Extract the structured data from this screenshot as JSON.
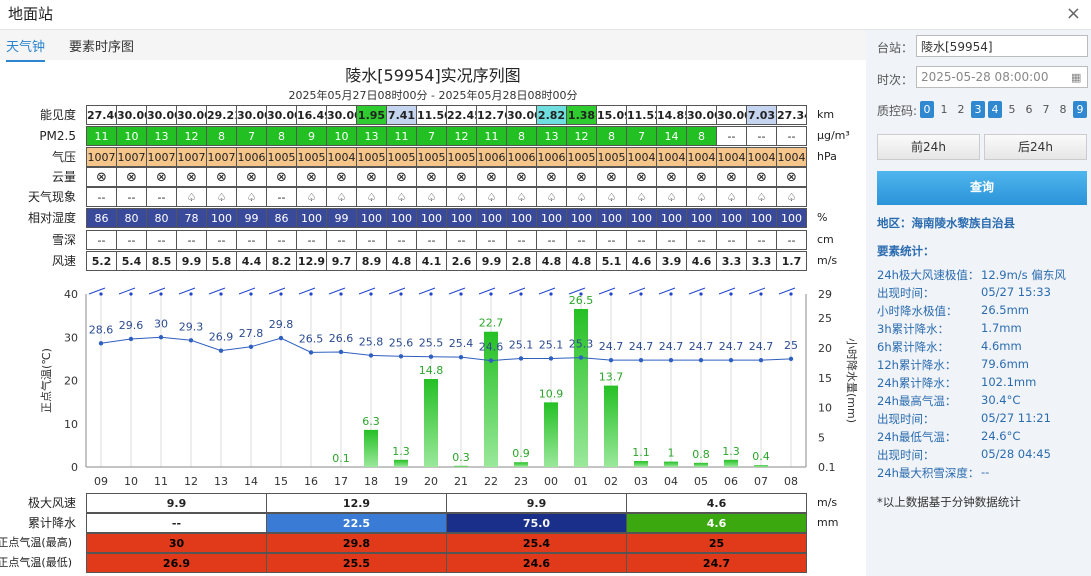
{
  "window": {
    "title": "地面站",
    "close": "×"
  },
  "tabs": [
    "天气钟",
    "要素时序图"
  ],
  "title": "陵水[59954]实况序列图",
  "subtitle": "2025年05月27日08时00分 - 2025年05月28日08时00分",
  "colors": {
    "accent": "#2b85d0",
    "vis_high": "#2ecc2e",
    "vis_mid": "#6fdede",
    "vis_low": "#c5d5f0",
    "pm_green": "#22c022",
    "press": "#f5c58a",
    "rh": "#3a4a9a",
    "bar": "#2fc42f",
    "line": "#2f5fbf"
  },
  "rows": [
    {
      "label": "能见度",
      "unit": "km",
      "values": [
        "27.40",
        "30.00",
        "30.00",
        "30.00",
        "29.21",
        "30.00",
        "30.00",
        "16.49",
        "30.00",
        "1.95",
        "7.41",
        "11.50",
        "22.45",
        "12.76",
        "30.00",
        "2.82",
        "1.38",
        "15.09",
        "11.52",
        "14.85",
        "30.00",
        "30.00",
        "7.03",
        "27.34"
      ]
    },
    {
      "label": "PM2.5",
      "unit": "μg/m³",
      "values": [
        "11",
        "10",
        "13",
        "12",
        "8",
        "7",
        "8",
        "9",
        "10",
        "13",
        "11",
        "7",
        "12",
        "11",
        "8",
        "13",
        "12",
        "8",
        "7",
        "14",
        "8",
        "--",
        "--",
        "--"
      ]
    },
    {
      "label": "气压",
      "unit": "hPa",
      "values": [
        "1007",
        "1007",
        "1007",
        "1007",
        "1007",
        "1006",
        "1005",
        "1005",
        "1004",
        "1005",
        "1005",
        "1005",
        "1005",
        "1006",
        "1006",
        "1006",
        "1005",
        "1005",
        "1004",
        "1004",
        "1004",
        "1004",
        "1004",
        "1004"
      ]
    },
    {
      "label": "云量",
      "unit": "",
      "values": [
        "⊗",
        "⊗",
        "⊗",
        "⊗",
        "⊗",
        "⊗",
        "⊗",
        "⊗",
        "⊗",
        "⊗",
        "⊗",
        "⊗",
        "⊗",
        "⊗",
        "⊗",
        "⊗",
        "⊗",
        "⊗",
        "⊗",
        "⊗",
        "⊗",
        "⊗",
        "⊗",
        "⊗"
      ]
    },
    {
      "label": "天气现象",
      "unit": "",
      "values": [
        "--",
        "--",
        "--",
        "♤",
        "♤",
        "♤",
        "--",
        "♤",
        "♤",
        "♤",
        "♤",
        "♤",
        "♤",
        "♤",
        "♤",
        "♤",
        "♤",
        "♤",
        "♤",
        "♤",
        "♤",
        "♤",
        "♤",
        "♤"
      ]
    },
    {
      "label": "相对湿度",
      "unit": "%",
      "values": [
        "86",
        "80",
        "80",
        "78",
        "100",
        "99",
        "86",
        "100",
        "99",
        "100",
        "100",
        "100",
        "100",
        "100",
        "100",
        "100",
        "100",
        "100",
        "100",
        "100",
        "100",
        "100",
        "100",
        "100"
      ]
    },
    {
      "label": "雪深",
      "unit": "cm",
      "values": [
        "--",
        "--",
        "--",
        "--",
        "--",
        "--",
        "--",
        "--",
        "--",
        "--",
        "--",
        "--",
        "--",
        "--",
        "--",
        "--",
        "--",
        "--",
        "--",
        "--",
        "--",
        "--",
        "--",
        "--"
      ]
    },
    {
      "label": "风速",
      "unit": "m/s",
      "values": [
        "5.2",
        "5.4",
        "8.5",
        "9.9",
        "5.8",
        "4.4",
        "8.2",
        "12.9",
        "9.7",
        "8.9",
        "4.8",
        "4.1",
        "2.6",
        "9.9",
        "2.8",
        "4.8",
        "4.8",
        "5.1",
        "4.6",
        "3.9",
        "4.6",
        "3.3",
        "3.3",
        "1.7"
      ]
    }
  ],
  "chart_data": {
    "type": "bar+line",
    "x": [
      "09",
      "10",
      "11",
      "12",
      "13",
      "14",
      "15",
      "16",
      "17",
      "18",
      "19",
      "20",
      "21",
      "22",
      "23",
      "00",
      "01",
      "02",
      "03",
      "04",
      "05",
      "06",
      "07",
      "08"
    ],
    "temperature": {
      "name": "正点气温(℃)",
      "values": [
        28.6,
        29.6,
        30,
        29.3,
        26.9,
        27.8,
        29.8,
        26.5,
        26.6,
        25.8,
        25.6,
        25.5,
        25.4,
        24.6,
        25.1,
        25.1,
        25.3,
        24.7,
        24.7,
        24.7,
        24.7,
        24.7,
        24.7,
        25
      ]
    },
    "precip": {
      "name": "小时降水量(mm)",
      "values": [
        null,
        null,
        null,
        null,
        null,
        null,
        null,
        null,
        0.1,
        6.3,
        1.3,
        14.8,
        0.3,
        22.7,
        0.9,
        10.9,
        26.5,
        13.7,
        1.1,
        1,
        0.8,
        1.3,
        0.4,
        null
      ]
    },
    "ylabel_left": "正点气温(℃)",
    "ylabel_right": "小时降水量(mm)",
    "y_left_ticks": [
      "40",
      "30",
      "20",
      "10",
      "0"
    ],
    "y_right_ticks": [
      "29",
      "25",
      "20",
      "15",
      "10",
      "5",
      "0.1"
    ],
    "y_left_lim": [
      0,
      40
    ],
    "y_right_lim": [
      0.1,
      29
    ]
  },
  "bottom": [
    {
      "label": "极大风速",
      "unit": "m/s",
      "values": [
        "9.9",
        "12.9",
        "9.9",
        "4.6"
      ]
    },
    {
      "label": "累计降水",
      "unit": "mm",
      "values": [
        "--",
        "22.5",
        "75.0",
        "4.6"
      ]
    },
    {
      "label": "正点气温(最高)",
      "unit": "",
      "values": [
        "30",
        "29.8",
        "25.4",
        "25"
      ]
    },
    {
      "label": "正点气温(最低)",
      "unit": "",
      "values": [
        "26.9",
        "25.5",
        "24.6",
        "24.7"
      ]
    }
  ],
  "sidebar": {
    "station_label": "台站：",
    "station_value": "陵水[59954]",
    "time_label": "时次：",
    "time_value": "2025-05-28 08:00:00",
    "qc_label": "质控码:",
    "qc_codes": [
      "0",
      "1",
      "2",
      "3",
      "4",
      "5",
      "6",
      "7",
      "8",
      "9"
    ],
    "prev_button": "前24h",
    "next_button": "后24h",
    "query_button": "查询",
    "region": "地区：海南陵水黎族自治县",
    "stats_title": "要素统计：",
    "stats": [
      {
        "k": "24h极大风速极值：",
        "v": "12.9m/s 偏东风"
      },
      {
        "k": "出现时间：",
        "v": "05/27 15:33"
      },
      {
        "k": "小时降水极值：",
        "v": "26.5mm"
      },
      {
        "k": "3h累计降水：",
        "v": "1.7mm"
      },
      {
        "k": "6h累计降水：",
        "v": "4.6mm"
      },
      {
        "k": "12h累计降水：",
        "v": "79.6mm"
      },
      {
        "k": "24h累计降水：",
        "v": "102.1mm"
      },
      {
        "k": "24h最高气温：",
        "v": "30.4°C"
      },
      {
        "k": "出现时间：",
        "v": "05/27 11:21"
      },
      {
        "k": "24h最低气温：",
        "v": "24.6°C"
      },
      {
        "k": "出现时间：",
        "v": "05/28 04:45"
      },
      {
        "k": "24h最大积雪深度：",
        "v": "--"
      }
    ],
    "note": "*以上数据基于分钟数据统计"
  }
}
